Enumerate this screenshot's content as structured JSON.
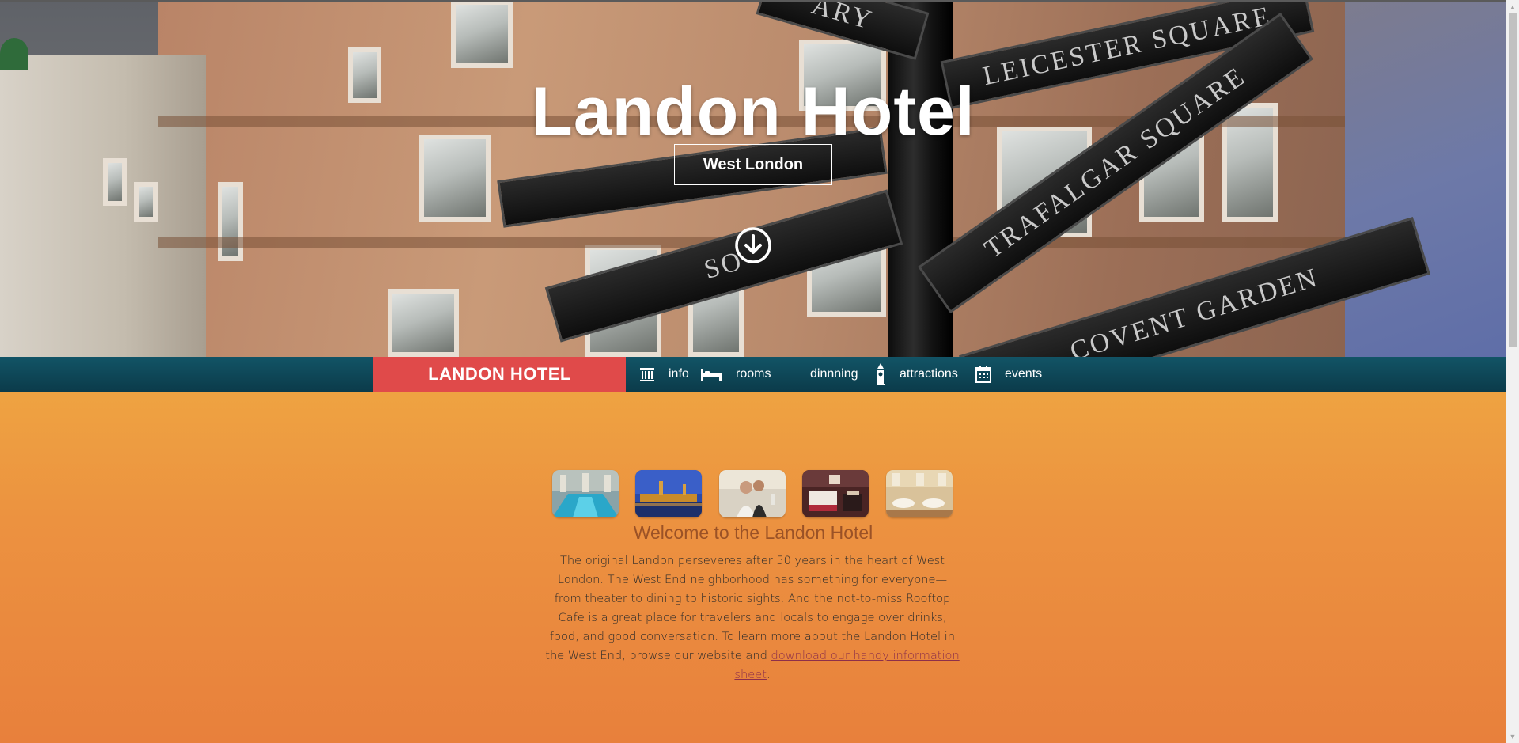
{
  "hero": {
    "title": "Landon Hotel",
    "subtitle": "West London",
    "scroll_icon": "arrow-circle-down-icon",
    "sign_labels": [
      "LEICESTER SQUARE",
      "TRAFALGAR SQUARE",
      "COVENT GARDEN",
      "SO",
      "ARY"
    ]
  },
  "nav": {
    "brand": "LANDON HOTEL",
    "items": [
      {
        "label": "info",
        "icon": "building-icon"
      },
      {
        "label": "rooms",
        "icon": "bed-icon"
      },
      {
        "label": "dinnning",
        "icon": "dining-icon"
      },
      {
        "label": "attractions",
        "icon": "big-ben-icon"
      },
      {
        "label": "events",
        "icon": "calendar-icon"
      }
    ]
  },
  "gallery": {
    "images": [
      "pool-image",
      "westminster-night-image",
      "wedding-couple-image",
      "hotel-room-image",
      "dining-hall-image"
    ]
  },
  "welcome": {
    "heading": "Welcome to the Landon Hotel",
    "body": "The original Landon perseveres after 50 years in the heart of West London. The West End neighborhood has something for everyone—from theater to dining to historic sights. And the not-to-miss Rooftop Cafe is a great place for travelers and locals to engage over drinks, food, and good conversation.  To learn more about the Landon Hotel in the West End, browse our website and ",
    "link_text": "download our handy information sheet",
    "trailing": "."
  },
  "colors": {
    "brand_red": "#e04a4a",
    "nav_teal": "#0b3b4a",
    "heading_brown": "#9b5226",
    "gradient_top": "#f2c847",
    "gradient_bottom": "#e8803c"
  }
}
